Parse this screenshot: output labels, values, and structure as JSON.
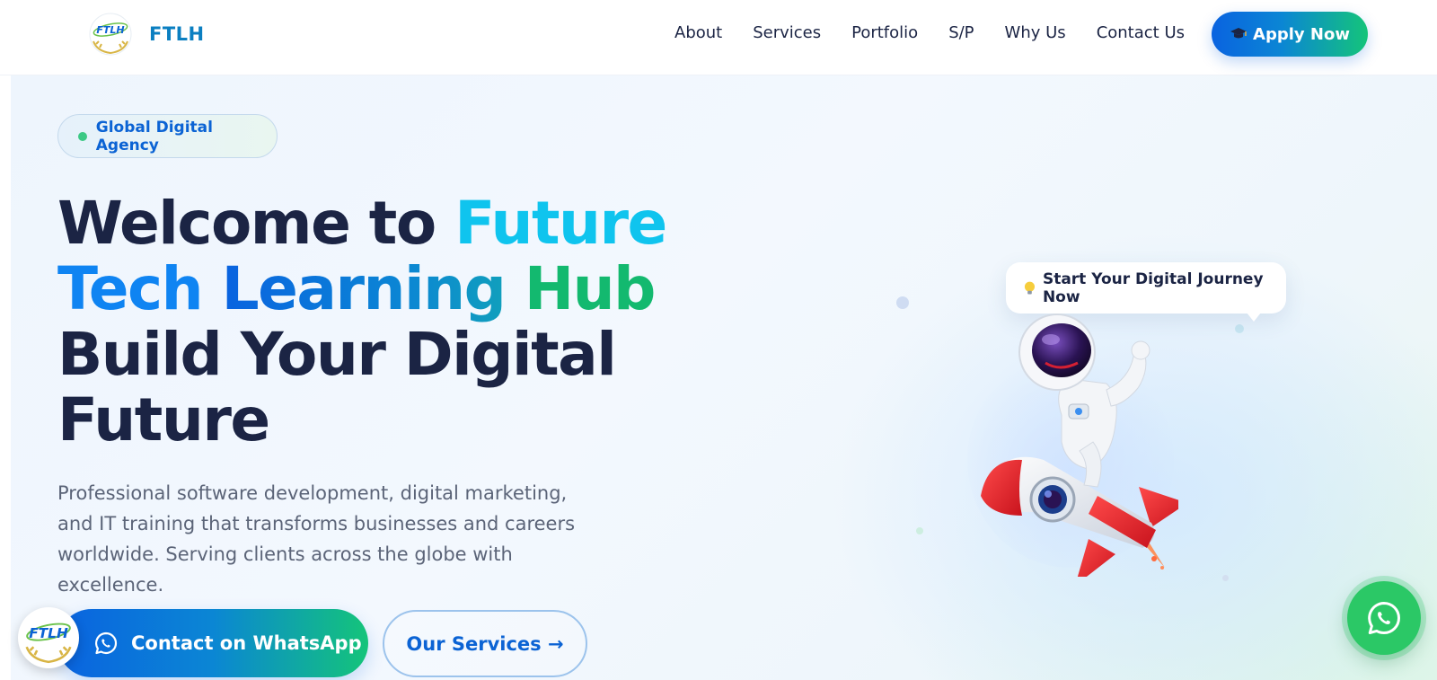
{
  "header": {
    "logo_text": "FTLH",
    "brand": "FTLH",
    "nav": [
      "About",
      "Services",
      "Portfolio",
      "S/P",
      "Why Us",
      "Contact Us"
    ],
    "apply_label": "Apply Now"
  },
  "hero": {
    "badge": "Global Digital Agency",
    "headline": {
      "welcome": "Welcome to ",
      "future": "Future",
      "tech": "Tech ",
      "learning": "Learning ",
      "hub": "Hub",
      "line3": "Build Your Digital",
      "line4": "Future"
    },
    "subtext": "Professional software development, digital marketing, and IT training that transforms businesses and careers worldwide. Serving clients across the globe with excellence.",
    "whatsapp_label": "Contact on WhatsApp",
    "services_label": "Our Services →",
    "bubble_text": "Start Your Digital Journey Now"
  },
  "icons": {
    "apply": "graduation-cap-icon",
    "bubble": "lightbulb-icon",
    "whatsapp": "whatsapp-icon"
  },
  "colors": {
    "primary_blue": "#0a63e0",
    "accent_green": "#14c47a",
    "cyan": "#0fc4ee",
    "heading": "#1b2444",
    "whatsapp_green": "#2bc866"
  }
}
